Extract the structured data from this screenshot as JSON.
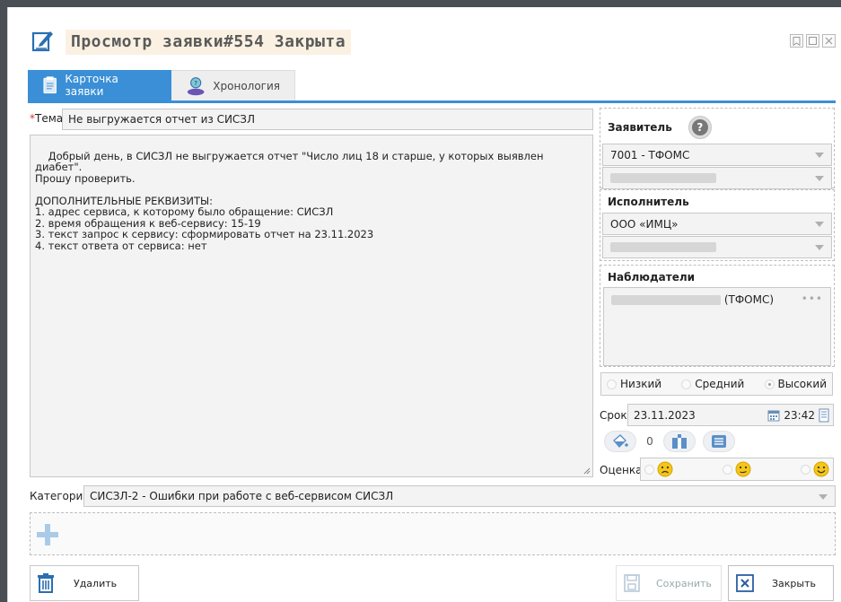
{
  "title": "Просмотр заявки#554 Закрыта",
  "tabs": [
    {
      "label": "Карточка заявки",
      "active": true
    },
    {
      "label": "Хронология",
      "active": false
    }
  ],
  "form": {
    "theme_label": "Тема",
    "theme_required_mark": "*",
    "theme_value": "Не выгружается отчет из СИСЗЛ",
    "description": "Добрый день, в СИСЗЛ не выгружается отчет \"Число лиц 18 и старше, у которых выявлен диабет\".\nПрошу проверить.\n\nДОПОЛНИТЕЛЬНЫЕ РЕКВИЗИТЫ:\n1. адрес сервиса, к которому было обращение: СИСЗЛ\n2. время обращения к веб-сервису: 15-19\n3. текст запрос к сервису: сформировать отчет на 23.11.2023\n4. текст ответа от сервиса: нет"
  },
  "applicant": {
    "title": "Заявитель",
    "help_glyph": "?",
    "org": "7001 - ТФОМС"
  },
  "executor": {
    "title": "Исполнитель",
    "org": "ООО «ИМЦ»"
  },
  "observers": {
    "title": "Наблюдатели",
    "entry_suffix": "(ТФОМС)",
    "more": "•••"
  },
  "priority": {
    "options": [
      "Низкий",
      "Средний",
      "Высокий"
    ],
    "selected": "Высокий"
  },
  "deadline": {
    "label": "Срок",
    "date": "23.11.2023",
    "time": "23:42"
  },
  "stats": {
    "count": "0"
  },
  "rating": {
    "label": "Оценка"
  },
  "category": {
    "label": "Категория",
    "value": "СИСЗЛ-2 - Ошибки при работе с веб-сервисом СИСЗЛ"
  },
  "buttons": {
    "delete": "Удалить",
    "save": "Сохранить",
    "close": "Закрыть"
  },
  "colors": {
    "accent": "#3a8fd6",
    "field_bg": "#f3f3f3",
    "title_bg": "#fbf1e3"
  }
}
